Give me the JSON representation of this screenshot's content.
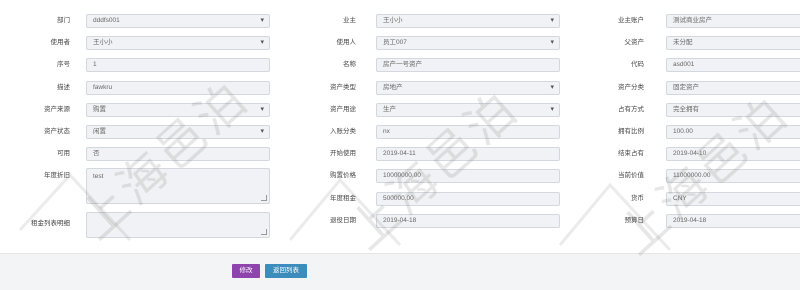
{
  "col1": {
    "labels": [
      "部门",
      "使用者",
      "序号",
      "描述",
      "资产来源",
      "资产状态",
      "可用",
      "年度折旧",
      "租金列表明细"
    ],
    "fields": {
      "dept": "dddfs001",
      "user": "王小小",
      "seq": "1",
      "desc": "fawkru",
      "source": "购置",
      "status": "闲置",
      "available": "否",
      "annual_dep": "test",
      "rent_detail": ""
    }
  },
  "col2": {
    "labels": [
      "业主",
      "使用人",
      "名称",
      "资产类型",
      "资产用途",
      "入账分类",
      "开始使用",
      "购置价格",
      "年度租金",
      "退役日期"
    ],
    "fields": {
      "owner": "王小小",
      "user2": "员工007",
      "name": "房产一号资产",
      "asset_type": "房地产",
      "asset_use": "生产",
      "account_cat": "nx",
      "start_date": "2019-04-11",
      "purchase_price": "10000000.00",
      "annual_rent": "500000.00",
      "retire_date": "2019-04-18"
    }
  },
  "col3": {
    "labels": [
      "业主账户",
      "父资产",
      "代码",
      "资产分类",
      "占有方式",
      "拥有比例",
      "结束占有",
      "当前价值",
      "货币",
      "预算日"
    ],
    "fields": {
      "owner_account": "测试商业房产",
      "parent_asset": "未分配",
      "code": "asd001",
      "asset_cat": "固定资产",
      "holding_mode": "完全拥有",
      "own_ratio": "100.00",
      "end_holding": "2019-04-10",
      "current_value": "11000000.00",
      "currency": "CNY",
      "budget_date": "2019-04-18"
    }
  },
  "footer": {
    "edit_label": "修改",
    "back_label": "返回列表"
  },
  "watermark": "上海邑泊"
}
